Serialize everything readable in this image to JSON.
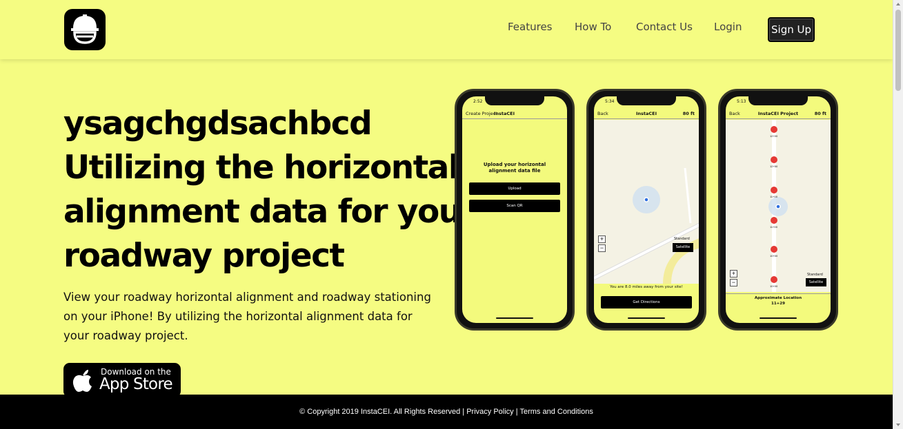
{
  "nav": {
    "links": [
      "Features",
      "How To",
      "Contact Us",
      "Login"
    ],
    "signup_label": "Sign Up"
  },
  "hero": {
    "title_lines": [
      "ysagchgdsachbcd",
      "Utilizing the horizontal",
      "alignment data for your",
      "roadway project"
    ],
    "description": "View your roadway horizontal alignment and roadway stationing on your iPhone! By utilizing the horizontal alignment data for your roadway project.",
    "appstore": {
      "small": "Download on the",
      "big": "App Store"
    }
  },
  "phones": [
    {
      "time": "2:52",
      "back": "Create Project",
      "title": "InstaCEI",
      "upload_heading": "Upload your horizontal alignment data file",
      "upload_button": "Upload",
      "scan_button": "Scan QR"
    },
    {
      "time": "5:34",
      "back": "Back",
      "title": "InstaCEI",
      "feet": "80 ft",
      "standard": "Standard",
      "satellite": "Satellite",
      "distance_text": "You are 8.0 miles away from your site!",
      "directions_button": "Get Directions"
    },
    {
      "time": "5:13",
      "back": "Back",
      "title": "InstaCEI Project",
      "feet": "80 ft",
      "stations": [
        "12+00",
        "12+50",
        "11+00",
        "11+00",
        "10+00",
        "10+00"
      ],
      "standard": "Standard",
      "satellite": "Satellite",
      "approx_label": "Approximate Location",
      "approx_value": "11+29"
    }
  ],
  "footer": {
    "copyright": "© Copyright 2019 InstaCEI. All Rights Reserved | ",
    "privacy": "Privacy Policy",
    "separator": " | ",
    "terms": "Terms and Conditions"
  },
  "colors": {
    "background": "#f5fc82",
    "dark": "#000000"
  }
}
